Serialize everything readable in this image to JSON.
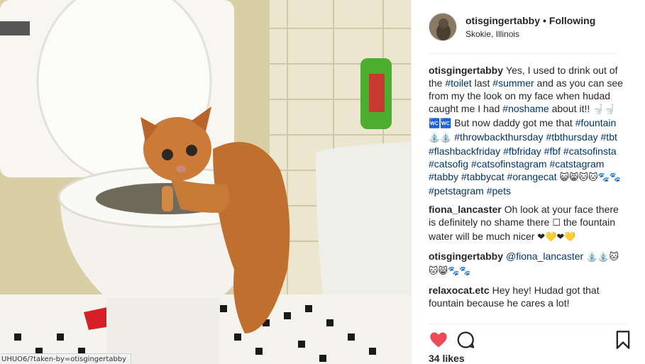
{
  "post": {
    "username": "otisgingertabby",
    "separator": "•",
    "follow_state": "Following",
    "location": "Skokie, Illinois",
    "avatar": "avatar-cat-photo"
  },
  "status_url": "UHUO6/?taken-by=otisgingertabby",
  "comments": [
    {
      "author": "otisgingertabby",
      "parts": [
        {
          "t": "text",
          "v": "Yes, I used to drink out of the "
        },
        {
          "t": "tag",
          "v": "#toilet"
        },
        {
          "t": "text",
          "v": " last "
        },
        {
          "t": "tag",
          "v": "#summer"
        },
        {
          "t": "text",
          "v": " and as you can see from my the look on my face when hudad caught me I had "
        },
        {
          "t": "tag",
          "v": "#noshame"
        },
        {
          "t": "text",
          "v": " about it!! "
        },
        {
          "t": "emo",
          "v": "🚽🚽🚾🚾"
        },
        {
          "t": "text",
          "v": " But now daddy got me that "
        },
        {
          "t": "tag",
          "v": "#fountain"
        },
        {
          "t": "text",
          "v": " "
        },
        {
          "t": "emo",
          "v": "⛲⛲"
        },
        {
          "t": "text",
          "v": " "
        },
        {
          "t": "tag",
          "v": "#throwbackthursday"
        },
        {
          "t": "text",
          "v": " "
        },
        {
          "t": "tag",
          "v": "#tbthursday"
        },
        {
          "t": "text",
          "v": " "
        },
        {
          "t": "tag",
          "v": "#tbt"
        },
        {
          "t": "text",
          "v": " "
        },
        {
          "t": "tag",
          "v": "#flashbackfriday"
        },
        {
          "t": "text",
          "v": " "
        },
        {
          "t": "tag",
          "v": "#fbfriday"
        },
        {
          "t": "text",
          "v": " "
        },
        {
          "t": "tag",
          "v": "#fbf"
        },
        {
          "t": "text",
          "v": " "
        },
        {
          "t": "tag",
          "v": "#catsofinsta"
        },
        {
          "t": "text",
          "v": " "
        },
        {
          "t": "tag",
          "v": "#catsofig"
        },
        {
          "t": "text",
          "v": " "
        },
        {
          "t": "tag",
          "v": "#catsofinstagram"
        },
        {
          "t": "text",
          "v": " "
        },
        {
          "t": "tag",
          "v": "#catstagram"
        },
        {
          "t": "text",
          "v": " "
        },
        {
          "t": "tag",
          "v": "#tabby"
        },
        {
          "t": "text",
          "v": " "
        },
        {
          "t": "tag",
          "v": "#tabbycat"
        },
        {
          "t": "text",
          "v": " "
        },
        {
          "t": "tag",
          "v": "#orangecat"
        },
        {
          "t": "text",
          "v": " "
        },
        {
          "t": "emo",
          "v": "😺😸🐱🐱🐾🐾"
        },
        {
          "t": "text",
          "v": " "
        },
        {
          "t": "tag",
          "v": "#petstagram"
        },
        {
          "t": "text",
          "v": " "
        },
        {
          "t": "tag",
          "v": "#pets"
        }
      ]
    },
    {
      "author": "fiona_lancaster",
      "parts": [
        {
          "t": "text",
          "v": "Oh look at your face there is definitely no shame there "
        },
        {
          "t": "emo",
          "v": "☐"
        },
        {
          "t": "text",
          "v": " the fountain water will be much nicer "
        },
        {
          "t": "emo",
          "v": "❤💛❤💛"
        }
      ]
    },
    {
      "author": "otisgingertabby",
      "parts": [
        {
          "t": "tag",
          "v": "@fiona_lancaster"
        },
        {
          "t": "text",
          "v": " "
        },
        {
          "t": "emo",
          "v": "⛲⛲🐱🐱😸🐾🐾"
        }
      ]
    },
    {
      "author": "relaxocat.etc",
      "parts": [
        {
          "t": "text",
          "v": "Hey hey! Hudad got that fountain because he cares a lot!"
        }
      ]
    }
  ],
  "actions": {
    "like_icon": "heart-filled-icon",
    "comment_icon": "comment-bubble-icon",
    "save_icon": "bookmark-icon",
    "like_color": "#ed4956"
  },
  "likes_text": "34 likes"
}
